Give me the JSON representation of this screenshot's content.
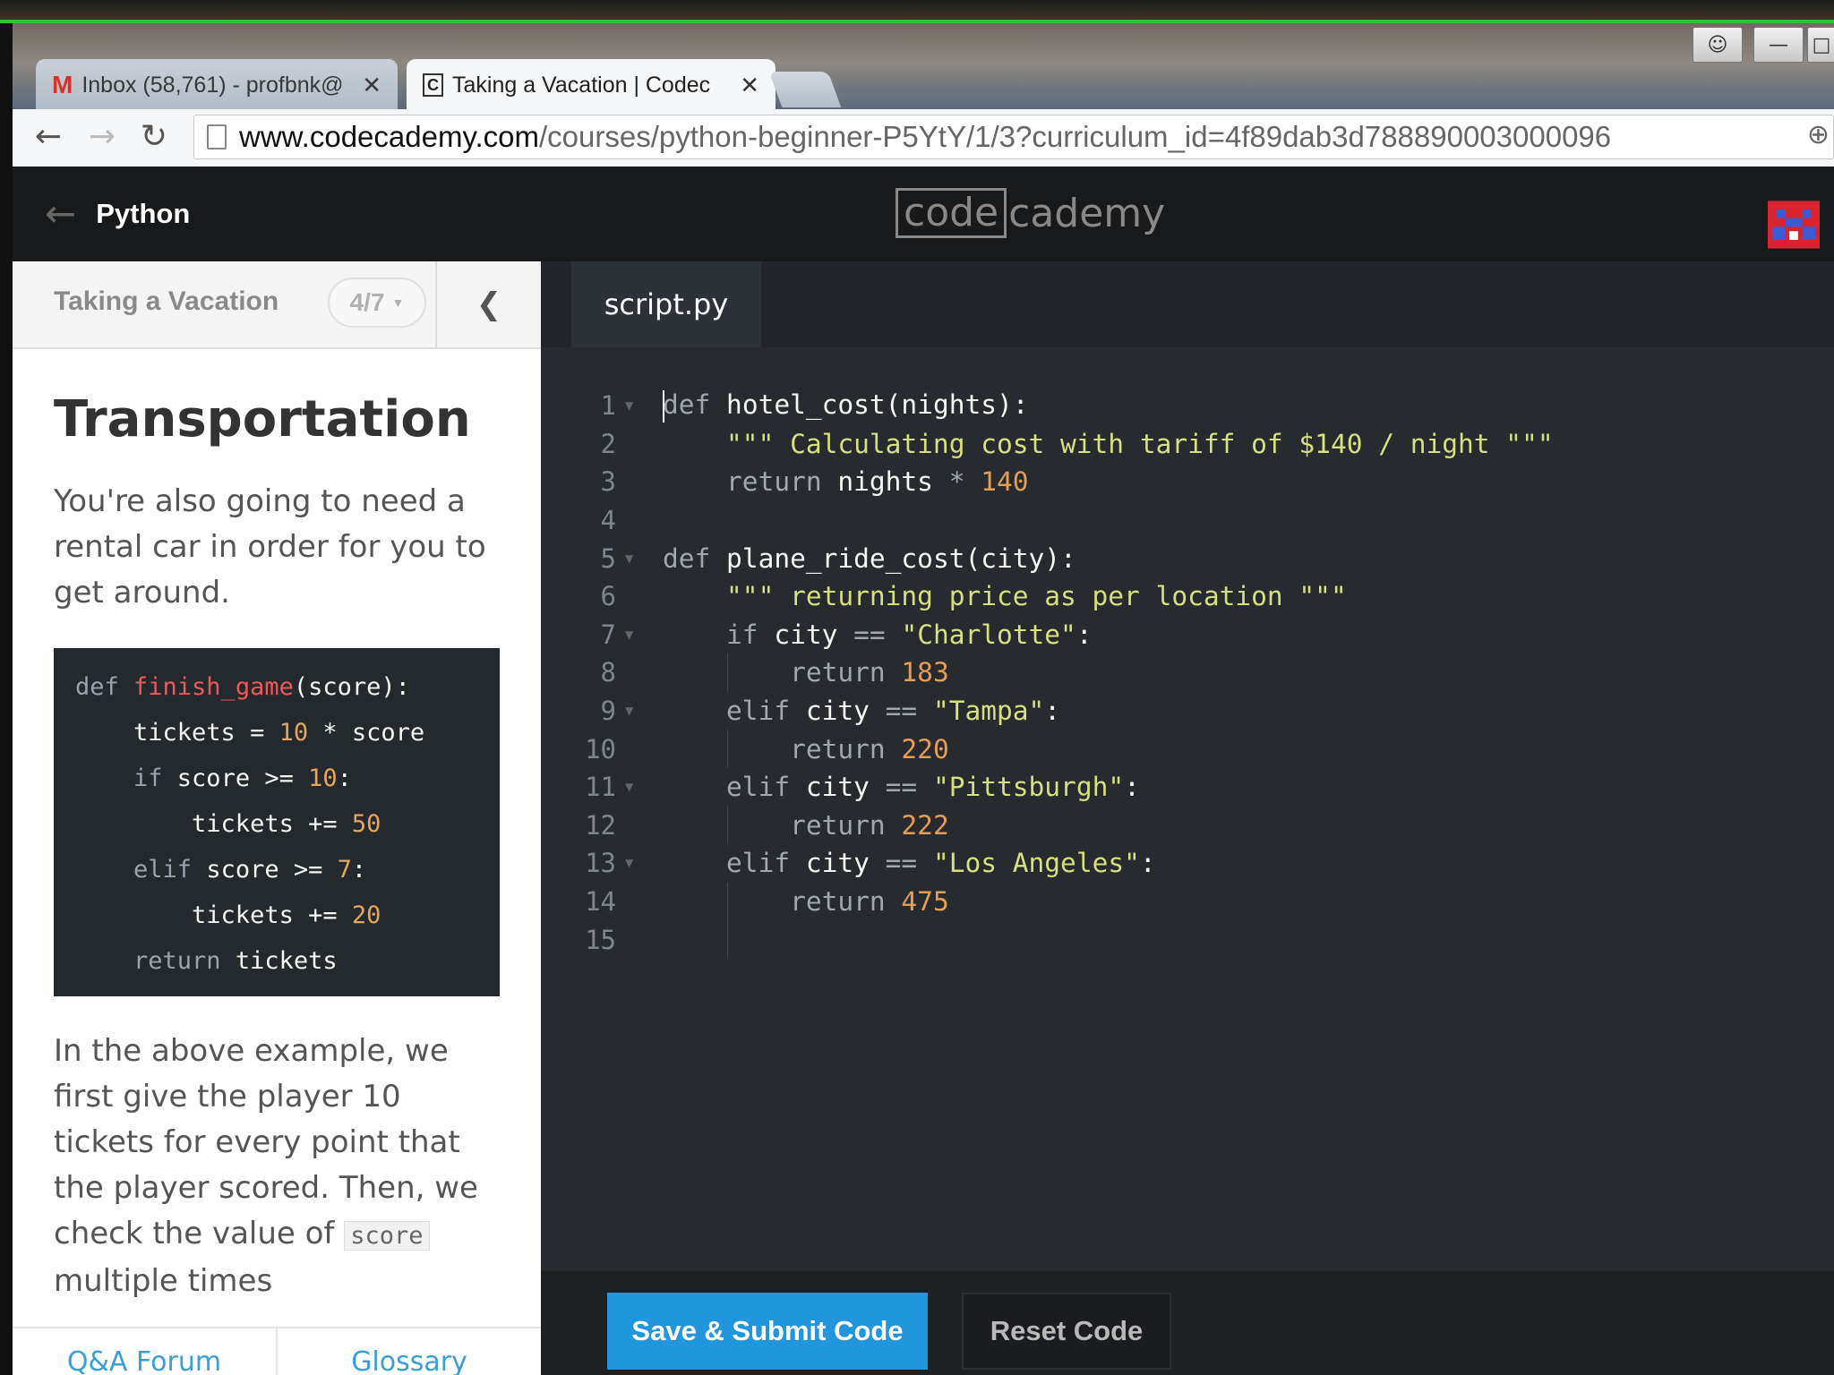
{
  "browser": {
    "tabs": [
      {
        "title": "Inbox (58,761) - profbnk@",
        "active": false
      },
      {
        "title": "Taking a Vacation | Codec",
        "active": true
      }
    ],
    "url_host": "www.codecademy.com",
    "url_path": "/courses/python-beginner-P5YtY/1/3?curriculum_id=4f89dab3d788890003000096"
  },
  "header": {
    "back_label": "Python",
    "logo_box": "code",
    "logo_rest": "cademy"
  },
  "lesson": {
    "unit_title": "Taking a Vacation",
    "progress": "4/7",
    "heading": "Transportation",
    "intro": "You're also going to need a rental car in order for you to get around.",
    "explanation_before": "In the above example, we first give the player 10 tickets for every point that the player scored. Then, we check the value of ",
    "explanation_code": "score",
    "explanation_after": " multiple times",
    "footer_links": [
      "Q&A Forum",
      "Glossary"
    ]
  },
  "example_code": [
    [
      {
        "t": "def ",
        "c": "kw"
      },
      {
        "t": "finish_game",
        "c": "fn"
      },
      {
        "t": "(score):",
        "c": "var"
      }
    ],
    [
      {
        "t": "    tickets = ",
        "c": "var"
      },
      {
        "t": "10",
        "c": "num"
      },
      {
        "t": " * score",
        "c": "var"
      }
    ],
    [
      {
        "t": "    if ",
        "c": "kw"
      },
      {
        "t": "score >= ",
        "c": "var"
      },
      {
        "t": "10",
        "c": "num"
      },
      {
        "t": ":",
        "c": "var"
      }
    ],
    [
      {
        "t": "        tickets += ",
        "c": "var"
      },
      {
        "t": "50",
        "c": "num"
      }
    ],
    [
      {
        "t": "    elif ",
        "c": "kw"
      },
      {
        "t": "score >= ",
        "c": "var"
      },
      {
        "t": "7",
        "c": "num"
      },
      {
        "t": ":",
        "c": "var"
      }
    ],
    [
      {
        "t": "        tickets += ",
        "c": "var"
      },
      {
        "t": "20",
        "c": "num"
      }
    ],
    [
      {
        "t": "    return ",
        "c": "kw"
      },
      {
        "t": "tickets",
        "c": "var"
      }
    ]
  ],
  "editor": {
    "file_name": "script.py",
    "lines": [
      {
        "n": "1",
        "fold": true,
        "parts": [
          {
            "t": "def",
            "c": "kw"
          },
          {
            "t": " hotel_cost(nights):",
            "c": "var"
          }
        ]
      },
      {
        "n": "2",
        "fold": false,
        "parts": [
          {
            "t": "    \"\"\" Calculating cost with tariff of $140 / night \"\"\"",
            "c": "str"
          }
        ]
      },
      {
        "n": "3",
        "fold": false,
        "parts": [
          {
            "t": "    return",
            "c": "kw"
          },
          {
            "t": " nights ",
            "c": "var"
          },
          {
            "t": "*",
            "c": "kw"
          },
          {
            "t": " ",
            "c": "var"
          },
          {
            "t": "140",
            "c": "num"
          }
        ]
      },
      {
        "n": "4",
        "fold": false,
        "parts": []
      },
      {
        "n": "5",
        "fold": true,
        "parts": [
          {
            "t": "def",
            "c": "kw"
          },
          {
            "t": " plane_ride_cost(city):",
            "c": "var"
          }
        ]
      },
      {
        "n": "6",
        "fold": false,
        "parts": [
          {
            "t": "    \"\"\" returning price as per location \"\"\"",
            "c": "str"
          }
        ]
      },
      {
        "n": "7",
        "fold": true,
        "parts": [
          {
            "t": "    if",
            "c": "kw"
          },
          {
            "t": " city ",
            "c": "var"
          },
          {
            "t": "==",
            "c": "kw"
          },
          {
            "t": " ",
            "c": "var"
          },
          {
            "t": "\"Charlotte\"",
            "c": "str"
          },
          {
            "t": ":",
            "c": "var"
          }
        ]
      },
      {
        "n": "8",
        "fold": false,
        "parts": [
          {
            "t": "        return",
            "c": "kw"
          },
          {
            "t": " ",
            "c": "var"
          },
          {
            "t": "183",
            "c": "num"
          }
        ]
      },
      {
        "n": "9",
        "fold": true,
        "parts": [
          {
            "t": "    elif",
            "c": "kw"
          },
          {
            "t": " city ",
            "c": "var"
          },
          {
            "t": "==",
            "c": "kw"
          },
          {
            "t": " ",
            "c": "var"
          },
          {
            "t": "\"Tampa\"",
            "c": "str"
          },
          {
            "t": ":",
            "c": "var"
          }
        ]
      },
      {
        "n": "10",
        "fold": false,
        "parts": [
          {
            "t": "        return",
            "c": "kw"
          },
          {
            "t": " ",
            "c": "var"
          },
          {
            "t": "220",
            "c": "num"
          }
        ]
      },
      {
        "n": "11",
        "fold": true,
        "parts": [
          {
            "t": "    elif",
            "c": "kw"
          },
          {
            "t": " city ",
            "c": "var"
          },
          {
            "t": "==",
            "c": "kw"
          },
          {
            "t": " ",
            "c": "var"
          },
          {
            "t": "\"Pittsburgh\"",
            "c": "str"
          },
          {
            "t": ":",
            "c": "var"
          }
        ]
      },
      {
        "n": "12",
        "fold": false,
        "parts": [
          {
            "t": "        return",
            "c": "kw"
          },
          {
            "t": " ",
            "c": "var"
          },
          {
            "t": "222",
            "c": "num"
          }
        ]
      },
      {
        "n": "13",
        "fold": true,
        "parts": [
          {
            "t": "    elif",
            "c": "kw"
          },
          {
            "t": " city ",
            "c": "var"
          },
          {
            "t": "==",
            "c": "kw"
          },
          {
            "t": " ",
            "c": "var"
          },
          {
            "t": "\"Los Angeles\"",
            "c": "str"
          },
          {
            "t": ":",
            "c": "var"
          }
        ]
      },
      {
        "n": "14",
        "fold": false,
        "parts": [
          {
            "t": "        return",
            "c": "kw"
          },
          {
            "t": " ",
            "c": "var"
          },
          {
            "t": "475",
            "c": "num"
          }
        ]
      },
      {
        "n": "15",
        "fold": false,
        "parts": []
      }
    ],
    "submit_label": "Save & Submit Code",
    "reset_label": "Reset Code"
  },
  "colors": {
    "accent_blue": "#2196dd",
    "editor_bg": "#272b30",
    "header_bg": "#18191b"
  }
}
